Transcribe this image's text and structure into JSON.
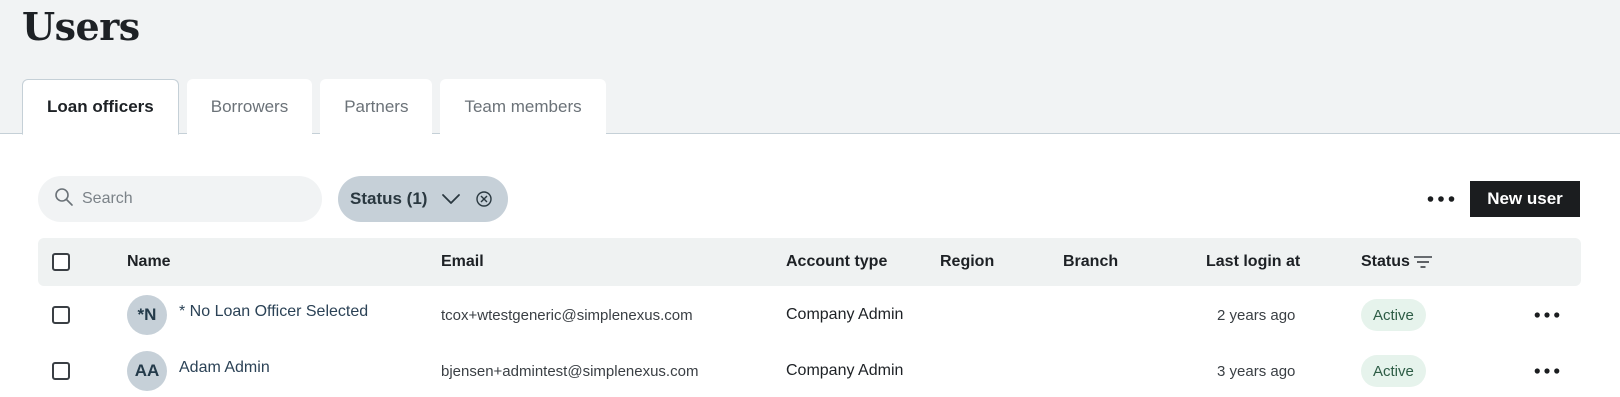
{
  "page": {
    "title": "Users"
  },
  "tabs": [
    {
      "label": "Loan officers",
      "active": true
    },
    {
      "label": "Borrowers",
      "active": false
    },
    {
      "label": "Partners",
      "active": false
    },
    {
      "label": "Team members",
      "active": false
    }
  ],
  "toolbar": {
    "search_placeholder": "Search",
    "status_filter_label": "Status (1)",
    "new_user_label": "New user"
  },
  "table": {
    "columns": [
      "Name",
      "Email",
      "Account type",
      "Region",
      "Branch",
      "Last login at",
      "Status"
    ],
    "rows": [
      {
        "initials": "*N",
        "name": "* No Loan Officer Selected",
        "email": "tcox+wtestgeneric@simplenexus.com",
        "account_type": "Company Admin",
        "region": "",
        "branch": "",
        "last_login": "2 years ago",
        "status": "Active"
      },
      {
        "initials": "AA",
        "name": "Adam Admin",
        "email": "bjensen+admintest@simplenexus.com",
        "account_type": "Company Admin",
        "region": "",
        "branch": "",
        "last_login": "3 years ago",
        "status": "Active"
      }
    ]
  },
  "icons": {
    "search": "search-icon",
    "chevron": "chevron-down-icon",
    "clear": "clear-circle-icon",
    "more": "more-horizontal-icon",
    "filter": "filter-lines-icon"
  },
  "colors": {
    "primary_button": "#1b1d1f",
    "status_chip": "#c6d0d8",
    "active_badge": "#e6f3ec",
    "header_bg": "#eff2f2"
  }
}
